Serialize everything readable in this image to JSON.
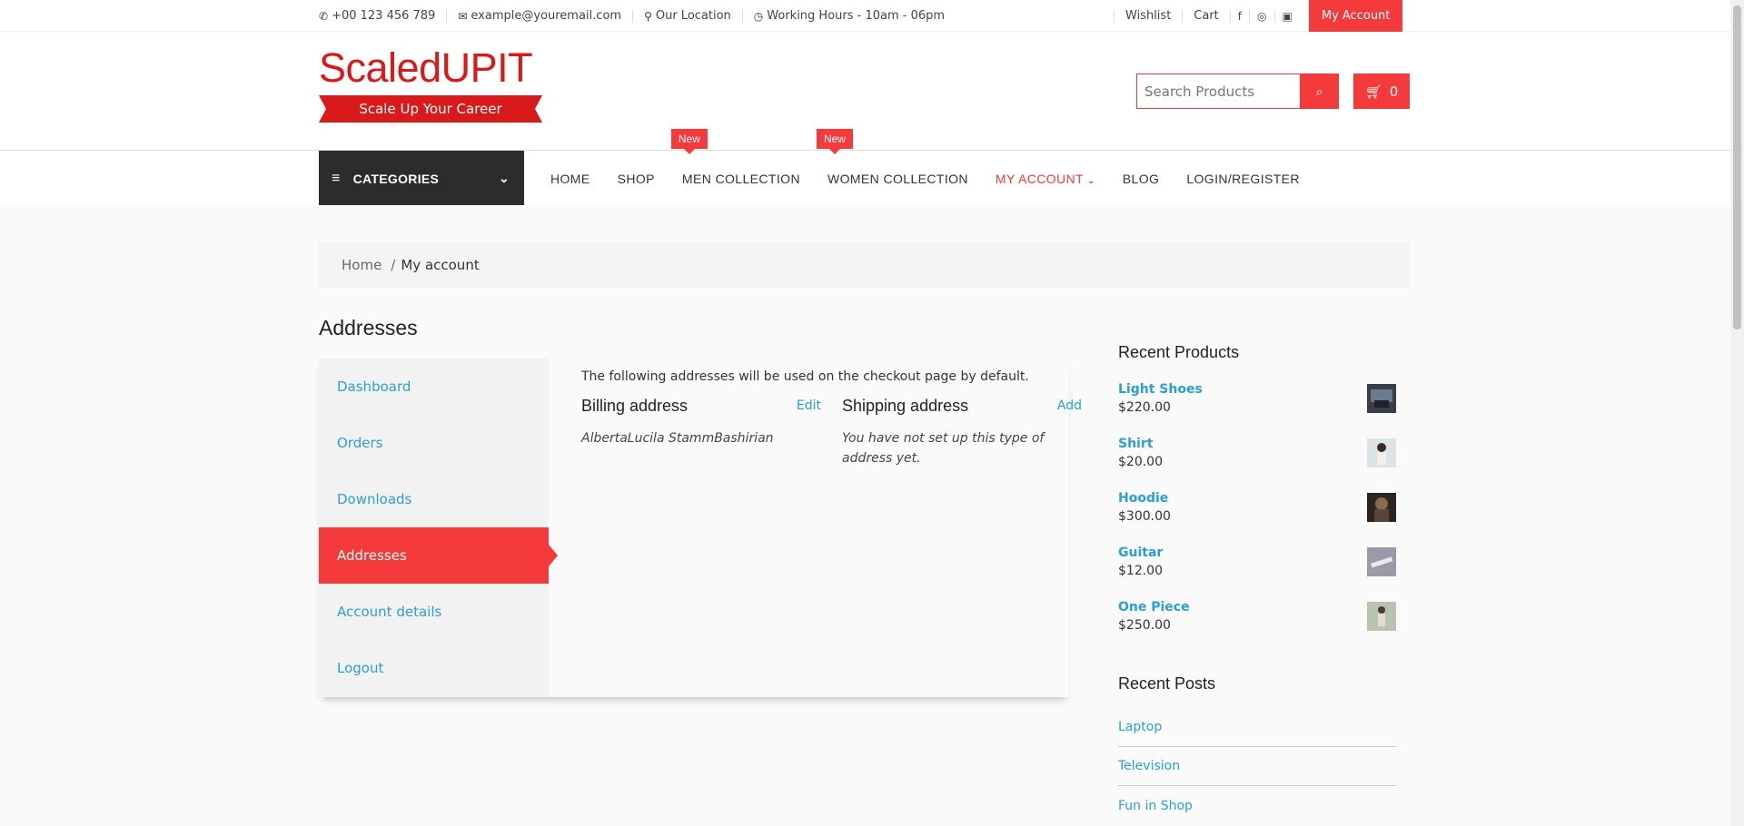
{
  "topbar": {
    "phone": "+00 123 456 789",
    "email": "example@youremail.com",
    "location": "Our Location",
    "hours": "Working Hours - 10am - 06pm",
    "wishlist": "Wishlist",
    "cart": "Cart",
    "social_icons": [
      "facebook-icon",
      "instagram-icon",
      "camera-icon"
    ],
    "my_account": "My Account"
  },
  "header": {
    "logo_text": "ScaledUPIT",
    "tagline": "Scale Up Your Career",
    "search_placeholder": "Search Products",
    "cart_count": "0"
  },
  "nav": {
    "categories_label": "CATEGORIES",
    "links": [
      {
        "label": "HOME"
      },
      {
        "label": "SHOP"
      },
      {
        "label": "MEN COLLECTION",
        "badge": "New"
      },
      {
        "label": "WOMEN COLLECTION",
        "badge": "New"
      },
      {
        "label": "MY ACCOUNT",
        "active": true
      },
      {
        "label": "BLOG"
      },
      {
        "label": "LOGIN/REGISTER"
      }
    ]
  },
  "breadcrumb": {
    "home": "Home",
    "separator": "/",
    "current": "My account"
  },
  "page_title": "Addresses",
  "account_nav": [
    {
      "label": "Dashboard"
    },
    {
      "label": "Orders"
    },
    {
      "label": "Downloads"
    },
    {
      "label": "Addresses",
      "active": true
    },
    {
      "label": "Account details"
    },
    {
      "label": "Logout"
    }
  ],
  "addresses": {
    "intro": "The following addresses will be used on the checkout page by default.",
    "billing": {
      "title": "Billing address",
      "action": "Edit",
      "text": "AlbertaLucila StammBashirian"
    },
    "shipping": {
      "title": "Shipping address",
      "action": "Add",
      "text": "You have not set up this type of address yet."
    }
  },
  "sidebar": {
    "recent_products_title": "Recent Products",
    "products": [
      {
        "name": "Light Shoes",
        "price": "$220.00"
      },
      {
        "name": "Shirt",
        "price": "$20.00"
      },
      {
        "name": "Hoodie",
        "price": "$300.00"
      },
      {
        "name": "Guitar",
        "price": "$12.00"
      },
      {
        "name": "One Piece",
        "price": "$250.00"
      }
    ],
    "recent_posts_title": "Recent Posts",
    "posts": [
      "Laptop",
      "Television",
      "Fun in Shop"
    ]
  },
  "colors": {
    "accent": "#f43a3a",
    "logo": "#d81a1a",
    "link": "#2a9fd6",
    "dark": "#2c2c2c"
  }
}
